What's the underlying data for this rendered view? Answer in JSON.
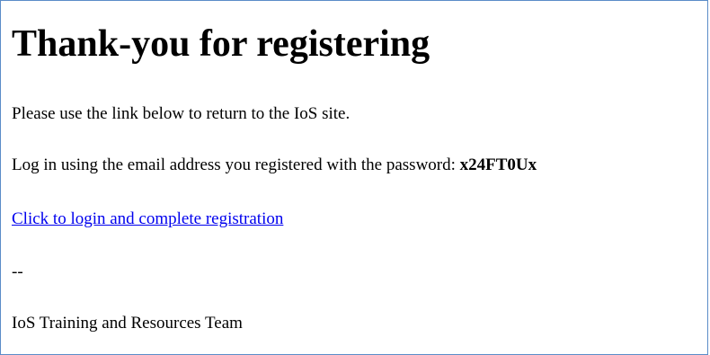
{
  "email": {
    "title": "Thank-you for registering",
    "intro_text": "Please use the link below to return to the IoS site.",
    "login_instruction": "Log in using the email address you registered with the password: ",
    "password": "x24FT0Ux",
    "login_link_text": "Click to login and complete registration",
    "signature_separator": "--",
    "signature": "IoS Training and Resources Team",
    "colors": {
      "border": "#5b8cc8",
      "link": "#0000ee",
      "text": "#000000",
      "background": "#ffffff"
    }
  }
}
